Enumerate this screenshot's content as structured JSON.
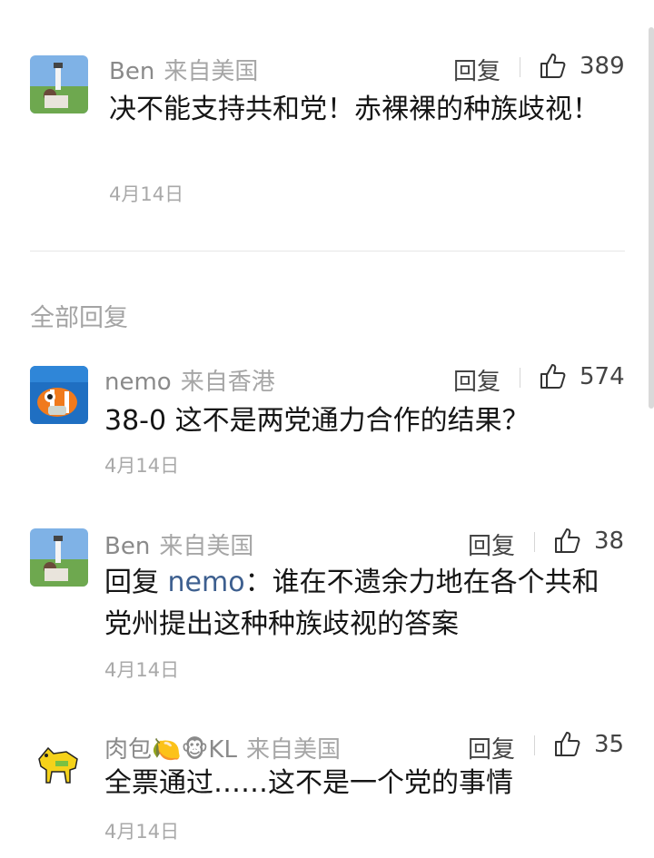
{
  "top_comment": {
    "author": "Ben",
    "location": "来自美国",
    "reply_label": "回复",
    "likes": "389",
    "text": "决不能支持共和党！赤裸裸的种族歧视！",
    "date": "4月14日"
  },
  "section_title": "全部回复",
  "replies": [
    {
      "author": "nemo",
      "location": "来自香港",
      "reply_label": "回复",
      "likes": "574",
      "text": "38-0 这不是两党通力合作的结果？",
      "date": "4月14日"
    },
    {
      "author": "Ben",
      "location": "来自美国",
      "reply_label": "回复",
      "likes": "38",
      "reply_prefix": "回复",
      "reply_to": "nemo",
      "text": "：谁在不遗余力地在各个共和党州提出这种种族歧视的答案",
      "date": "4月14日"
    },
    {
      "author": "肉包🍋🐵KL",
      "location": "来自美国",
      "reply_label": "回复",
      "likes": "35",
      "text": "全票通过……这不是一个党的事情",
      "date": "4月14日"
    }
  ],
  "colors": {
    "link": "#3d5f8f",
    "text": "#151515",
    "muted": "#a9a9a9"
  }
}
